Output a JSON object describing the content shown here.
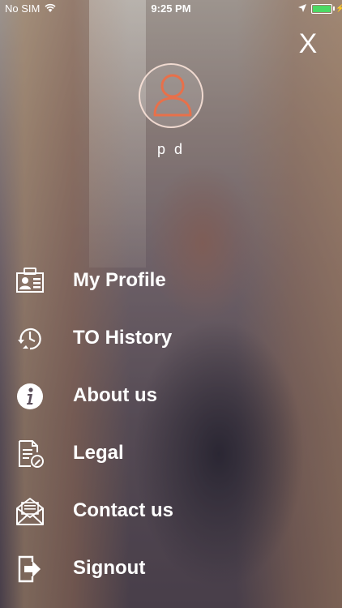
{
  "status_bar": {
    "carrier": "No SIM",
    "time": "9:25 PM"
  },
  "close_label": "X",
  "user": {
    "name": "p d"
  },
  "menu": {
    "items": [
      {
        "label": "My Profile",
        "icon": "id-card-icon"
      },
      {
        "label": "TO History",
        "icon": "clock-history-icon"
      },
      {
        "label": "About us",
        "icon": "info-icon"
      },
      {
        "label": "Legal",
        "icon": "document-edit-icon"
      },
      {
        "label": "Contact us",
        "icon": "envelope-icon"
      },
      {
        "label": "Signout",
        "icon": "signout-icon"
      }
    ]
  },
  "colors": {
    "avatar_accent": "#e8704a",
    "battery": "#4cd964",
    "text": "#ffffff"
  }
}
